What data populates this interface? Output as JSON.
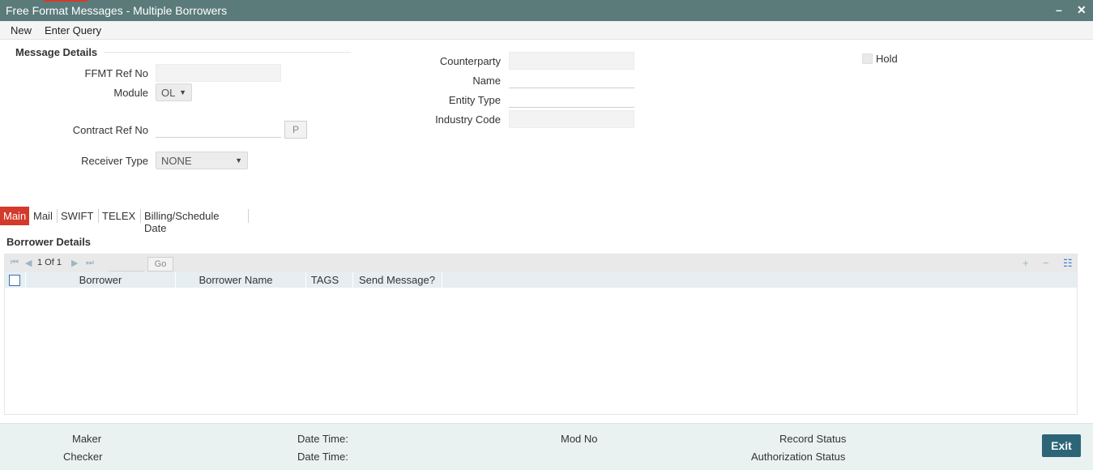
{
  "window": {
    "title": "Free Format Messages - Multiple Borrowers",
    "minimize": "–",
    "close": "✕"
  },
  "menu": {
    "new": "New",
    "enter_query": "Enter Query"
  },
  "message_details": {
    "heading": "Message Details",
    "ffmt_ref_no_label": "FFMT Ref No",
    "ffmt_ref_no_value": "",
    "module_label": "Module",
    "module_value": "OL",
    "contract_ref_no_label": "Contract Ref No",
    "contract_ref_no_value": "",
    "p_button": "P",
    "receiver_type_label": "Receiver Type",
    "receiver_type_value": "NONE",
    "counterparty_label": "Counterparty",
    "counterparty_value": "",
    "name_label": "Name",
    "name_value": "",
    "entity_type_label": "Entity Type",
    "entity_type_value": "",
    "industry_code_label": "Industry Code",
    "industry_code_value": "",
    "hold_label": "Hold",
    "hold_checked": false
  },
  "tabs": [
    {
      "label": "Main",
      "active": true
    },
    {
      "label": "Mail",
      "active": false
    },
    {
      "label": "SWIFT",
      "active": false
    },
    {
      "label": "TELEX",
      "active": false
    },
    {
      "label": "Billing/Schedule Date",
      "active": false
    }
  ],
  "borrower_details": {
    "heading": "Borrower Details",
    "pager": "1 Of 1",
    "go_button": "Go",
    "columns": [
      "Borrower",
      "Borrower Name",
      "TAGS",
      "Send Message?"
    ],
    "rows": []
  },
  "footer": {
    "maker_label": "Maker",
    "checker_label": "Checker",
    "date_time_label_1": "Date Time:",
    "date_time_label_2": "Date Time:",
    "mod_no_label": "Mod No",
    "record_status_label": "Record Status",
    "authorization_status_label": "Authorization Status",
    "exit_button": "Exit"
  },
  "colors": {
    "title_bar": "#5b7a7a",
    "accent": "#d33a2c",
    "exit_button": "#2b6577",
    "footer": "#eaf1f1"
  }
}
